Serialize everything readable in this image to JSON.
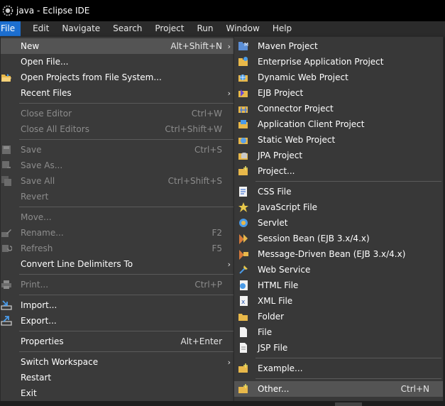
{
  "window": {
    "title": "java - Eclipse IDE"
  },
  "menubar": {
    "items": [
      {
        "id": "file",
        "label": "File"
      },
      {
        "id": "edit",
        "label": "Edit"
      },
      {
        "id": "navigate",
        "label": "Navigate"
      },
      {
        "id": "search",
        "label": "Search"
      },
      {
        "id": "project",
        "label": "Project"
      },
      {
        "id": "run",
        "label": "Run"
      },
      {
        "id": "window",
        "label": "Window"
      },
      {
        "id": "help",
        "label": "Help"
      }
    ]
  },
  "file_menu": {
    "new": {
      "label": "New",
      "shortcut": "Alt+Shift+N",
      "arrow": "›"
    },
    "open_file": {
      "label": "Open File..."
    },
    "open_projects": {
      "label": "Open Projects from File System..."
    },
    "recent_files": {
      "label": "Recent Files",
      "arrow": "›"
    },
    "close_editor": {
      "label": "Close Editor",
      "shortcut": "Ctrl+W"
    },
    "close_all_editors": {
      "label": "Close All Editors",
      "shortcut": "Ctrl+Shift+W"
    },
    "save": {
      "label": "Save",
      "shortcut": "Ctrl+S"
    },
    "save_as": {
      "label": "Save As..."
    },
    "save_all": {
      "label": "Save All",
      "shortcut": "Ctrl+Shift+S"
    },
    "revert": {
      "label": "Revert"
    },
    "move": {
      "label": "Move..."
    },
    "rename": {
      "label": "Rename...",
      "shortcut": "F2"
    },
    "refresh": {
      "label": "Refresh",
      "shortcut": "F5"
    },
    "convert_line_delimiters": {
      "label": "Convert Line Delimiters To",
      "arrow": "›"
    },
    "print": {
      "label": "Print...",
      "shortcut": "Ctrl+P"
    },
    "import": {
      "label": "Import..."
    },
    "export": {
      "label": "Export..."
    },
    "properties": {
      "label": "Properties",
      "shortcut": "Alt+Enter"
    },
    "switch_workspace": {
      "label": "Switch Workspace",
      "arrow": "›"
    },
    "restart": {
      "label": "Restart"
    },
    "exit": {
      "label": "Exit"
    }
  },
  "new_submenu": {
    "maven_project": {
      "label": "Maven Project"
    },
    "enterprise_application_project": {
      "label": "Enterprise Application Project"
    },
    "dynamic_web_project": {
      "label": "Dynamic Web Project"
    },
    "ejb_project": {
      "label": "EJB Project"
    },
    "connector_project": {
      "label": "Connector Project"
    },
    "application_client_project": {
      "label": "Application Client Project"
    },
    "static_web_project": {
      "label": "Static Web Project"
    },
    "jpa_project": {
      "label": "JPA Project"
    },
    "project": {
      "label": "Project..."
    },
    "css_file": {
      "label": "CSS File"
    },
    "javascript_file": {
      "label": "JavaScript File"
    },
    "servlet": {
      "label": "Servlet"
    },
    "session_bean": {
      "label": "Session Bean (EJB 3.x/4.x)"
    },
    "message_driven_bean": {
      "label": "Message-Driven Bean (EJB 3.x/4.x)"
    },
    "web_service": {
      "label": "Web Service"
    },
    "html_file": {
      "label": "HTML File"
    },
    "xml_file": {
      "label": "XML File"
    },
    "folder": {
      "label": "Folder"
    },
    "file": {
      "label": "File"
    },
    "jsp_file": {
      "label": "JSP File"
    },
    "example": {
      "label": "Example..."
    },
    "other": {
      "label": "Other...",
      "shortcut": "Ctrl+N"
    }
  },
  "colors": {
    "menubar_active": "#1d6fd0",
    "menu_bg": "#3a3a3a",
    "highlight": "#545454",
    "disabled_text": "#8c8c8c"
  }
}
